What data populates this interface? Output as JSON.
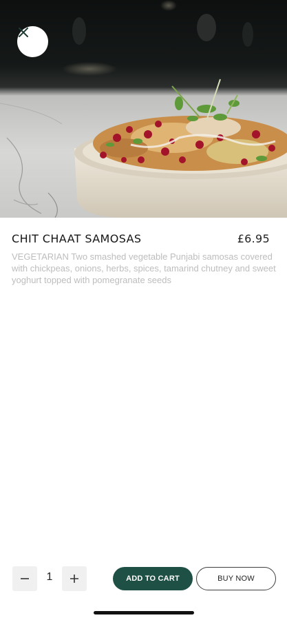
{
  "product": {
    "image_alt": "Chit chaat samosas in a ceramic bowl",
    "title": "CHIT CHAAT SAMOSAS",
    "price": "£6.95",
    "description": "VEGETARIAN Two smashed vegetable Punjabi samosas covered with chickpeas, onions, herbs, spices, tamarind chutney and sweet yoghurt topped with pomegranate seeds"
  },
  "quantity": {
    "value": "1",
    "decrement_icon": "minus-icon",
    "increment_icon": "plus-icon"
  },
  "actions": {
    "add_to_cart_label": "ADD TO CART",
    "buy_now_label": "BUY NOW"
  },
  "close_icon": "close-icon",
  "colors": {
    "primary": "#1f5045",
    "description_text": "#bdbdbd"
  }
}
